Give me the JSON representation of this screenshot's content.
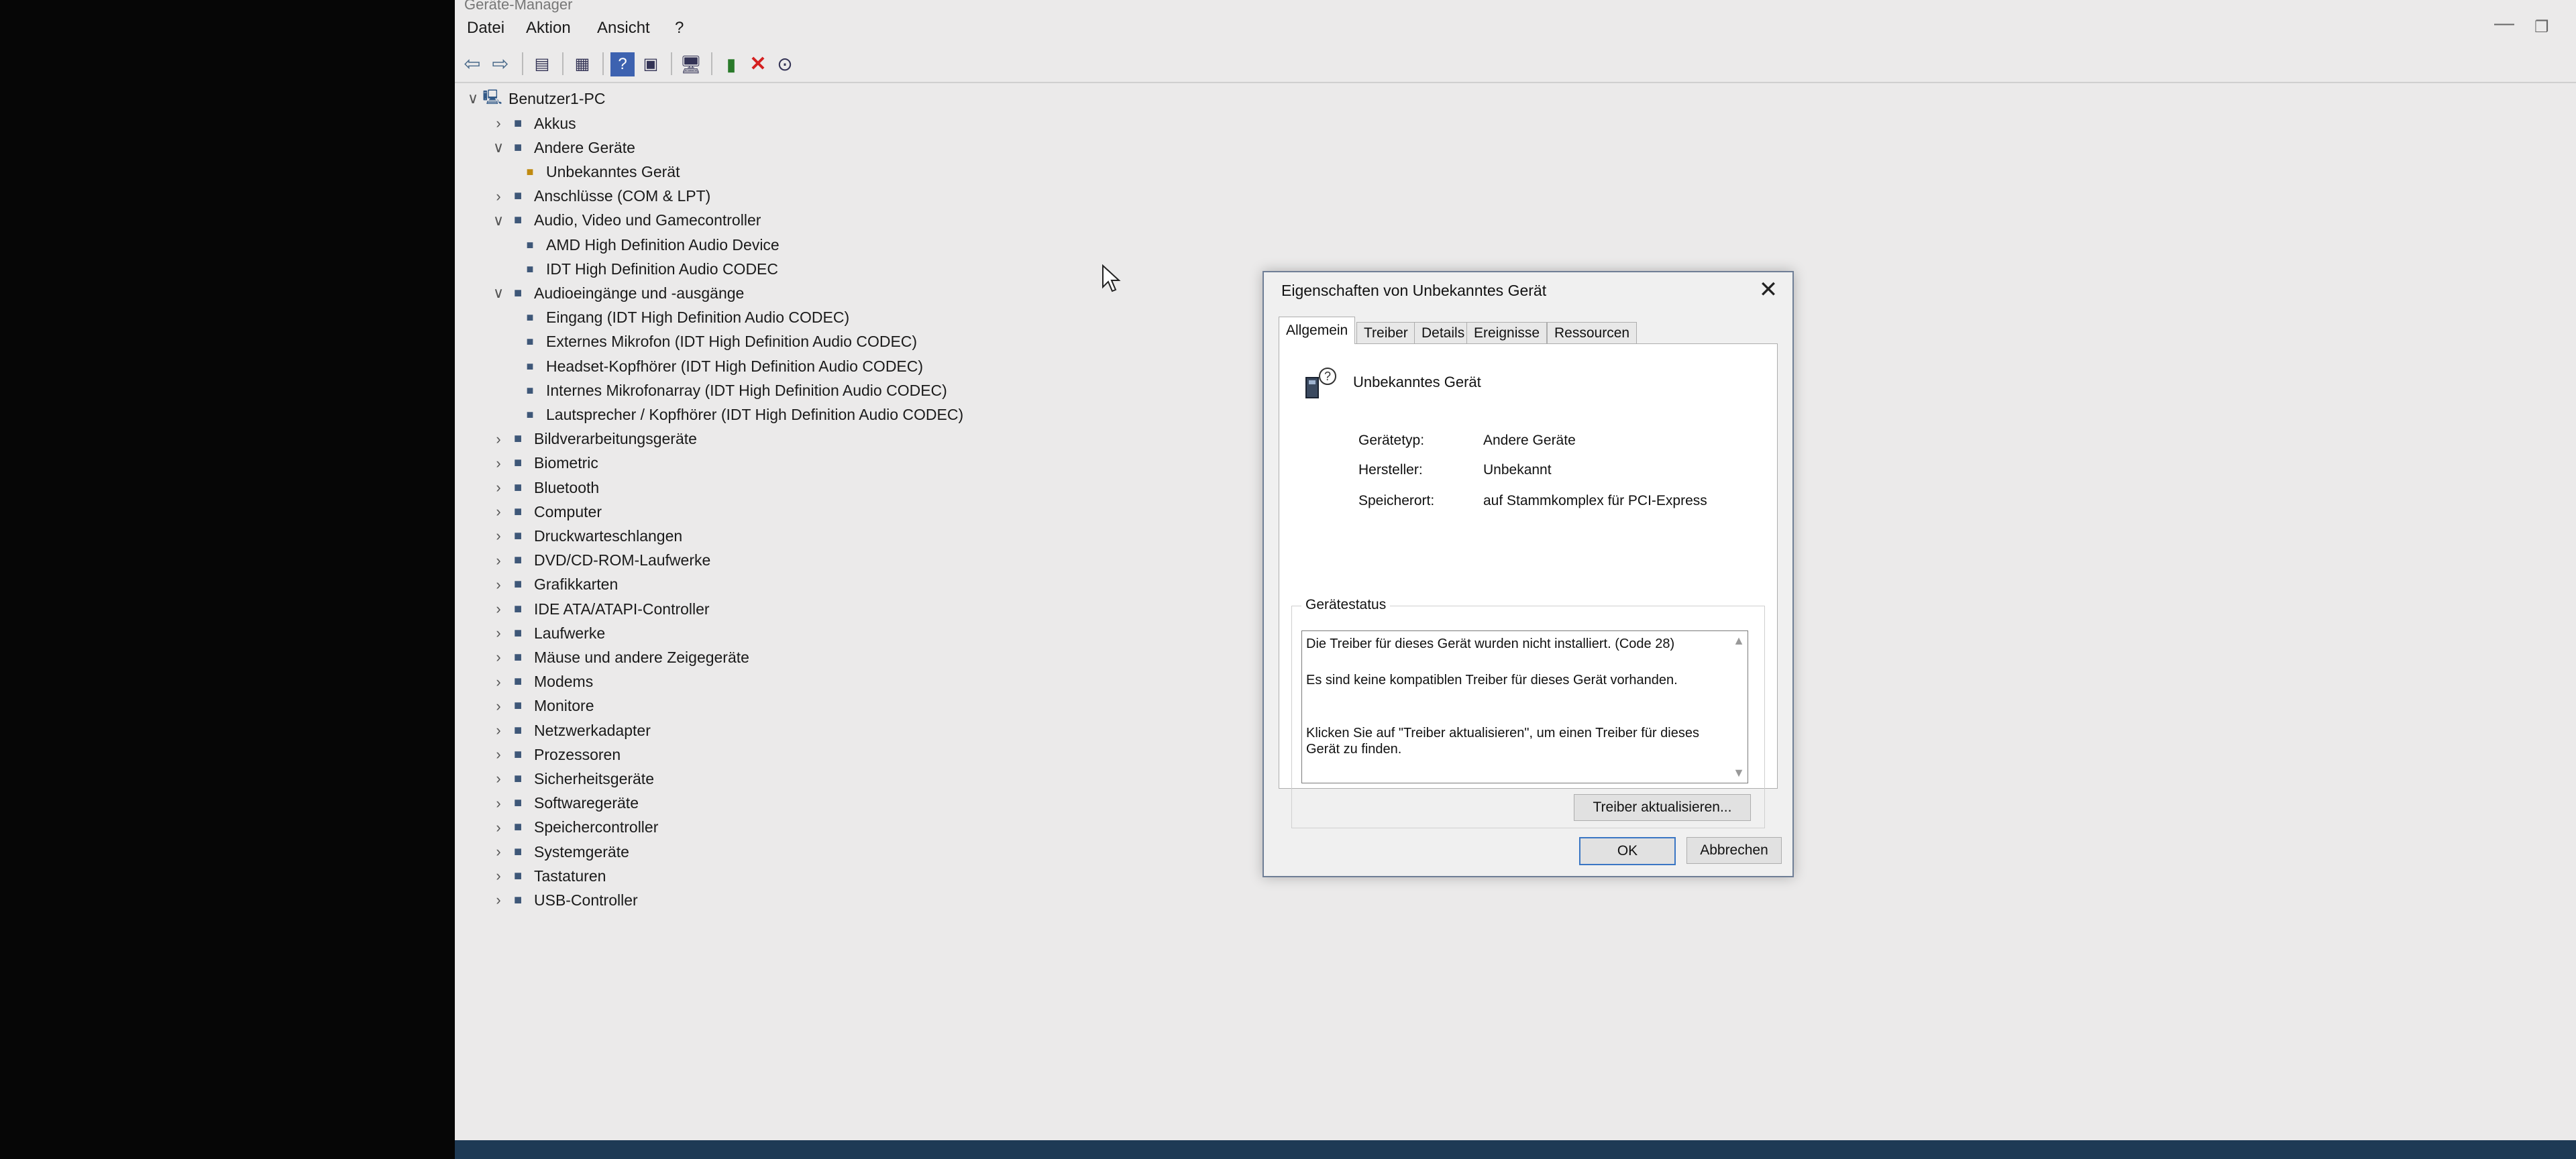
{
  "window": {
    "title": "Geräte-Manager",
    "menu": [
      "Datei",
      "Aktion",
      "Ansicht",
      "?"
    ]
  },
  "icons": {
    "back": "arrow-left-icon",
    "forward": "arrow-right-icon",
    "properties": "properties-icon",
    "help": "help-icon",
    "scan": "scan-hardware-icon",
    "update": "update-driver-icon",
    "remove": "remove-icon",
    "disable": "disable-icon"
  },
  "tree": {
    "root": "Benutzer1-PC",
    "items": [
      {
        "label": "Akkus",
        "level": 1,
        "expanded": false
      },
      {
        "label": "Andere Geräte",
        "level": 1,
        "expanded": true
      },
      {
        "label": "Unbekanntes Gerät",
        "level": 2
      },
      {
        "label": "Anschlüsse (COM & LPT)",
        "level": 1,
        "expanded": false
      },
      {
        "label": "Audio, Video und Gamecontroller",
        "level": 1,
        "expanded": true
      },
      {
        "label": "AMD High Definition Audio Device",
        "level": 2
      },
      {
        "label": "IDT High Definition Audio CODEC",
        "level": 2
      },
      {
        "label": "Audioeingänge und -ausgänge",
        "level": 1,
        "expanded": true
      },
      {
        "label": "Eingang (IDT High Definition Audio CODEC)",
        "level": 2
      },
      {
        "label": "Externes Mikrofon (IDT High Definition Audio CODEC)",
        "level": 2
      },
      {
        "label": "Headset-Kopfhörer (IDT High Definition Audio CODEC)",
        "level": 2
      },
      {
        "label": "Internes Mikrofonarray (IDT High Definition Audio CODEC)",
        "level": 2
      },
      {
        "label": "Lautsprecher / Kopfhörer (IDT High Definition Audio CODEC)",
        "level": 2
      },
      {
        "label": "Bildverarbeitungsgeräte",
        "level": 1,
        "expanded": false
      },
      {
        "label": "Biometric",
        "level": 1,
        "expanded": false
      },
      {
        "label": "Bluetooth",
        "level": 1,
        "expanded": false
      },
      {
        "label": "Computer",
        "level": 1,
        "expanded": false
      },
      {
        "label": "Druckwarteschlangen",
        "level": 1,
        "expanded": false
      },
      {
        "label": "DVD/CD-ROM-Laufwerke",
        "level": 1,
        "expanded": false
      },
      {
        "label": "Grafikkarten",
        "level": 1,
        "expanded": false
      },
      {
        "label": "IDE ATA/ATAPI-Controller",
        "level": 1,
        "expanded": false
      },
      {
        "label": "Laufwerke",
        "level": 1,
        "expanded": false
      },
      {
        "label": "Mäuse und andere Zeigegeräte",
        "level": 1,
        "expanded": false
      },
      {
        "label": "Modems",
        "level": 1,
        "expanded": false
      },
      {
        "label": "Monitore",
        "level": 1,
        "expanded": false
      },
      {
        "label": "Netzwerkadapter",
        "level": 1,
        "expanded": false
      },
      {
        "label": "Prozessoren",
        "level": 1,
        "expanded": false
      },
      {
        "label": "Sicherheitsgeräte",
        "level": 1,
        "expanded": false
      },
      {
        "label": "Softwaregeräte",
        "level": 1,
        "expanded": false
      },
      {
        "label": "Speichercontroller",
        "level": 1,
        "expanded": false
      },
      {
        "label": "Systemgeräte",
        "level": 1,
        "expanded": false
      },
      {
        "label": "Tastaturen",
        "level": 1,
        "expanded": false
      },
      {
        "label": "USB-Controller",
        "level": 1,
        "expanded": false
      }
    ]
  },
  "dialog": {
    "title": "Eigenschaften von Unbekanntes Gerät",
    "tabs": [
      "Allgemein",
      "Treiber",
      "Details",
      "Ereignisse",
      "Ressourcen"
    ],
    "device_name": "Unbekanntes Gerät",
    "props": [
      {
        "label": "Gerätetyp:",
        "value": "Andere Geräte"
      },
      {
        "label": "Hersteller:",
        "value": "Unbekannt"
      },
      {
        "label": "Speicherort:",
        "value": "auf Stammkomplex für PCI-Express"
      }
    ],
    "status_title": "Gerätestatus",
    "status_lines": [
      "Die Treiber für dieses Gerät wurden nicht installiert. (Code 28)",
      "Es sind keine kompatiblen Treiber für dieses Gerät vorhanden.",
      "Klicken Sie auf \"Treiber aktualisieren\", um einen Treiber für dieses Gerät zu finden."
    ],
    "update_button": "Treiber aktualisieren...",
    "ok": "OK",
    "cancel": "Abbrechen"
  }
}
